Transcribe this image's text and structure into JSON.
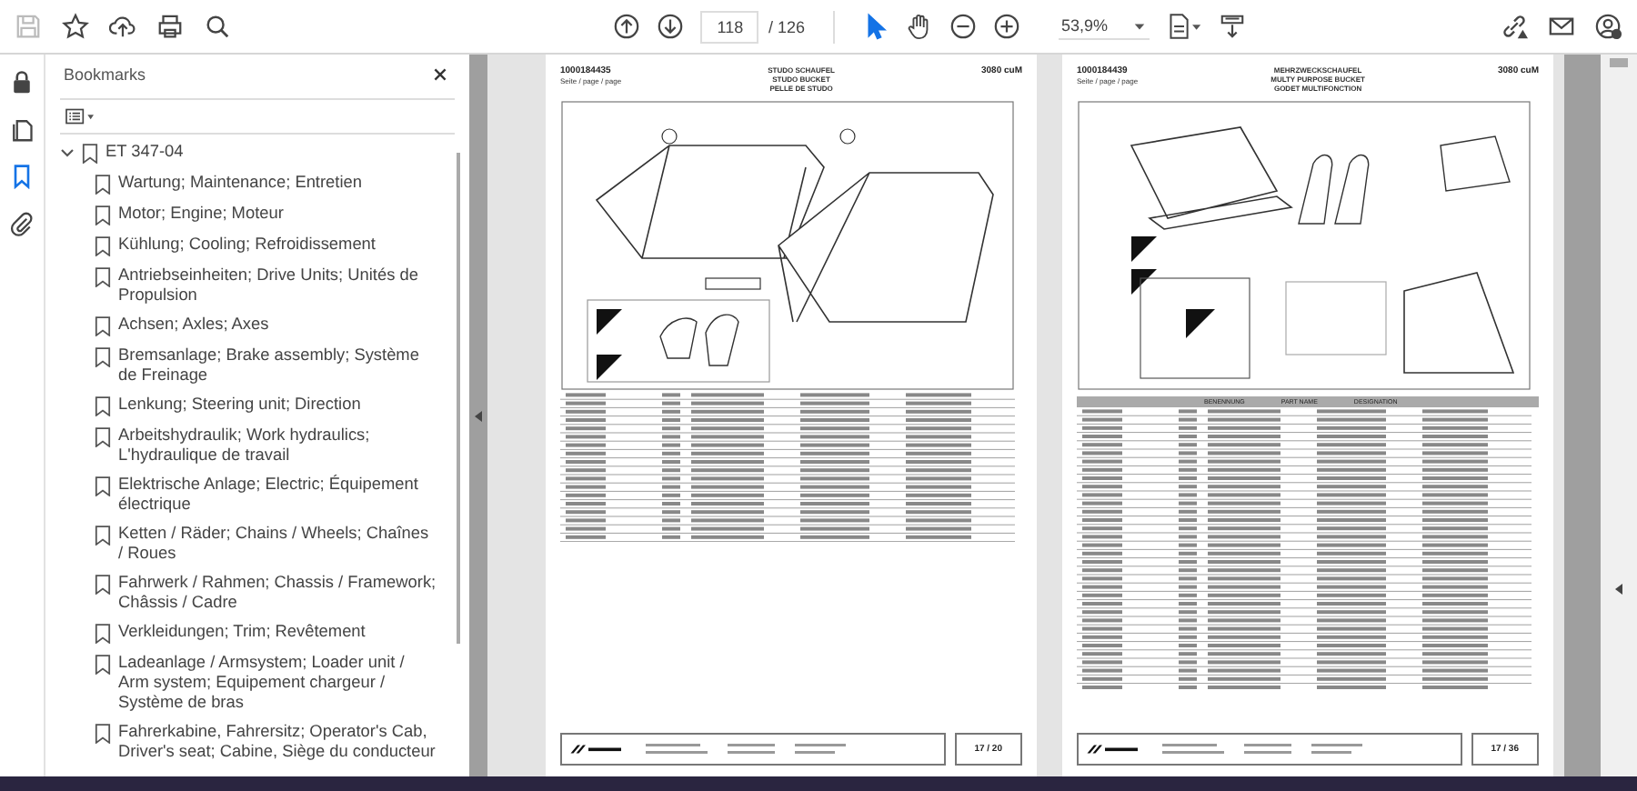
{
  "toolbar": {
    "page_current": "118",
    "page_separator": "/ 126",
    "zoom": "53,9%",
    "tools": [
      {
        "kind": "select",
        "selected": true
      },
      {
        "kind": "hand",
        "selected": false
      }
    ]
  },
  "side_rail": [
    {
      "kind": "lock",
      "selected": false
    },
    {
      "kind": "pages",
      "selected": false
    },
    {
      "kind": "bookmarks",
      "selected": true
    },
    {
      "kind": "attachment",
      "selected": false
    }
  ],
  "bookmarks": {
    "title": "Bookmarks",
    "tree": [
      {
        "label": "ET 347-04",
        "expanded": true,
        "children": [
          {
            "label": "Wartung; Maintenance; Entretien"
          },
          {
            "label": "Motor; Engine; Moteur"
          },
          {
            "label": "Kühlung; Cooling; Refroidissement"
          },
          {
            "label": "Antriebseinheiten; Drive Units; Unités de Propulsion"
          },
          {
            "label": "Achsen; Axles; Axes"
          },
          {
            "label": "Bremsanlage; Brake assembly; Système de Freinage"
          },
          {
            "label": "Lenkung; Steering unit; Direction"
          },
          {
            "label": "Arbeitshydraulik; Work hydraulics; L'hydraulique de travail"
          },
          {
            "label": "Elektrische Anlage; Electric; Équipement électrique"
          },
          {
            "label": "Ketten / Räder; Chains / Wheels; Chaînes / Roues"
          },
          {
            "label": "Fahrwerk / Rahmen; Chassis / Framework; Châssis / Cadre"
          },
          {
            "label": "Verkleidungen; Trim; Revêtement"
          },
          {
            "label": "Ladeanlage / Armsystem; Loader unit / Arm system; Equipement chargeur / Système de bras"
          },
          {
            "label": "Fahrerkabine, Fahrersitz; Operator's Cab, Driver's seat; Cabine, Siège du conducteur"
          }
        ]
      }
    ]
  },
  "pages": [
    {
      "kind": "studo",
      "doc_number": "1000184435",
      "subtitle": "Seite / page / page",
      "title_lines": [
        "STUDO SCHAUFEL",
        "STUDO BUCKET",
        "PELLE DE STUDO"
      ],
      "model": "3080 cuM",
      "footer_page": "17 / 20"
    },
    {
      "kind": "multi",
      "doc_number": "1000184439",
      "subtitle": "Seite / page / page",
      "title_lines": [
        "MEHRZWECKSCHAUFEL",
        "MULTY PURPOSE BUCKET",
        "GODET MULTIFONCTION"
      ],
      "model": "3080 cuM",
      "table_headers": [
        "BENENNUNG",
        "PART NAME",
        "DESIGNATION"
      ],
      "footer_page": "17 / 36"
    }
  ]
}
